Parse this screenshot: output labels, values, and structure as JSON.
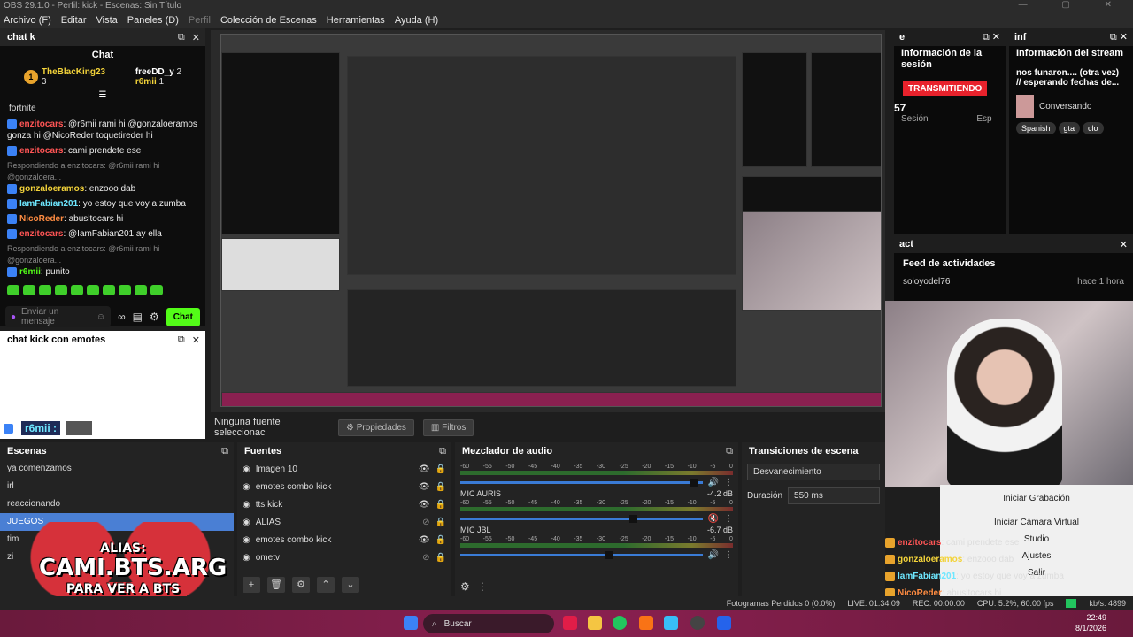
{
  "window": {
    "title": "OBS 29.1.0 - Perfil: kick - Escenas: Sin Título"
  },
  "menu": [
    "Archivo (F)",
    "Editar",
    "Vista",
    "Paneles (D)",
    "Perfil",
    "Colección de Escenas",
    "Herramientas",
    "Ayuda (H)"
  ],
  "chatk": {
    "dock_title": "chat k",
    "chat_label": "Chat",
    "leaders": [
      {
        "rank": "1",
        "name": "TheBlacKing23",
        "count": "3"
      },
      {
        "rank": "",
        "name": "freeDD_y",
        "count": "2"
      },
      {
        "rank": "",
        "name": "r6mii",
        "count": "1"
      }
    ],
    "pinned": "fortnite",
    "messages": [
      {
        "reply": "",
        "user": "enzitocars",
        "user_color": "#ff5555",
        "text": ": @r6mii rami hi @gonzaloeramos gonza hi @NicoReder toquetireder hi"
      },
      {
        "reply": "",
        "user": "enzitocars",
        "user_color": "#ff5555",
        "text": ": cami prendete ese"
      },
      {
        "reply": "Respondiendo a enzitocars: @r6mii rami hi @gonzaloera...",
        "user": "gonzaloeramos",
        "user_color": "#f3d33a",
        "text": ": enzooo dab"
      },
      {
        "reply": "",
        "user": "IamFabian201",
        "user_color": "#6ee7ff",
        "text": ": yo estoy que voy a zumba"
      },
      {
        "reply": "",
        "user": "NicoReder",
        "user_color": "#ff8c42",
        "text": ": abusltocars hi"
      },
      {
        "reply": "",
        "user": "enzitocars",
        "user_color": "#ff5555",
        "text": ": @IamFabian201 ay ella"
      },
      {
        "reply": "Respondiendo a enzitocars: @r6mii rami hi @gonzaloera...",
        "user": "r6mii",
        "user_color": "#53fc18",
        "text": ": punito"
      }
    ],
    "input_placeholder": "Enviar un mensaje",
    "send_label": "Chat"
  },
  "chatemotes": {
    "dock_title": "chat kick con emotes",
    "footer_user": "r6mii :"
  },
  "source_bar": {
    "label": "Ninguna fuente seleccionac",
    "props": "Propiedades",
    "filters": "Filtros"
  },
  "escenas": {
    "title": "Escenas",
    "items": [
      "ya comenzamos",
      "irl",
      "reaccionando",
      "JUEGOS",
      "tim",
      "zi"
    ],
    "selected_index": 3
  },
  "fuentes": {
    "title": "Fuentes",
    "items": [
      {
        "name": "Imagen 10",
        "icon": "image-icon",
        "visible": true
      },
      {
        "name": "emotes combo kick",
        "icon": "globe-icon",
        "visible": true
      },
      {
        "name": "tts kick",
        "icon": "globe-icon",
        "visible": true
      },
      {
        "name": "ALIAS",
        "icon": "text-icon",
        "visible": false
      },
      {
        "name": "emotes combo kick",
        "icon": "globe-icon",
        "visible": true
      },
      {
        "name": "ometv",
        "icon": "window-icon",
        "visible": false
      }
    ]
  },
  "mezclador": {
    "title": "Mezclador de audio",
    "ticks": [
      "-60",
      "-55",
      "-50",
      "-45",
      "-40",
      "-35",
      "-30",
      "-25",
      "-20",
      "-15",
      "-10",
      "-5",
      "0"
    ],
    "channels": [
      {
        "name": "",
        "db": "",
        "level": 0.95,
        "muted": false
      },
      {
        "name": "MIC AURIS",
        "db": "-4.2 dB",
        "level": 0.7,
        "muted": true
      },
      {
        "name": "MIC JBL",
        "db": "-6.7 dB",
        "level": 0.6,
        "muted": false
      }
    ]
  },
  "transiciones": {
    "title": "Transiciones de escena",
    "transition": "Desvanecimiento",
    "duration_label": "Duración",
    "duration_value": "550 ms"
  },
  "right": {
    "e_title": "e",
    "e_heading": "Información de la sesión",
    "e_status": "TRANSMITIENDO",
    "e_viewers": "57",
    "e_sesion": "Sesión",
    "e_esp": "Esp",
    "inf_title": "inf",
    "inf_heading": "Información del stream",
    "inf_text": "nos funaron.... (otra vez) // esperando fechas de...",
    "inf_category": "Conversando",
    "inf_tags": [
      "Spanish",
      "gta",
      "clo"
    ],
    "act_title": "act",
    "act_heading": "Feed de actividades",
    "act_user": "soloyodel76",
    "act_time": "hace 1 hora"
  },
  "controls": {
    "iniciar_grabacion": "Iniciar Grabación",
    "iniciar_camara": "Iniciar Cámara Virtual",
    "studio": "Studio",
    "ajustes": "Ajustes",
    "salir": "Salir"
  },
  "overlay_chat": [
    {
      "user": "enzitocars",
      "text": ": cami prendete ese"
    },
    {
      "user": "gonzaloeramos",
      "text": ": enzooo dab"
    },
    {
      "user": "IamFabian201",
      "text": ": yo estoy que voy a zumba"
    },
    {
      "user": "NicoReder",
      "text": ": abusltocars hi"
    },
    {
      "user": "enzitocars",
      "text": ": @IamFabian201 ay ella"
    },
    {
      "user": "r6mii",
      "text": ":"
    }
  ],
  "status": {
    "dropped": "Fotogramas Perdidos 0 (0.0%)",
    "live": "LIVE: 01:34:09",
    "rec": "REC: 00:00:00",
    "cpu": "CPU: 5.2%, 60.00 fps",
    "kbs": "kb/s: 4899"
  },
  "taskbar": {
    "search": "Buscar",
    "time": "22:49",
    "date": "8/1/2026"
  },
  "alias": {
    "line1": "ALIAS:",
    "line2": "CAMI.BTS.ARG",
    "line3": "PARA VER A BTS"
  },
  "colors": {
    "kick_green": "#53fc18",
    "live_red": "#e8222c",
    "selected_blue": "#4a7fd4"
  }
}
